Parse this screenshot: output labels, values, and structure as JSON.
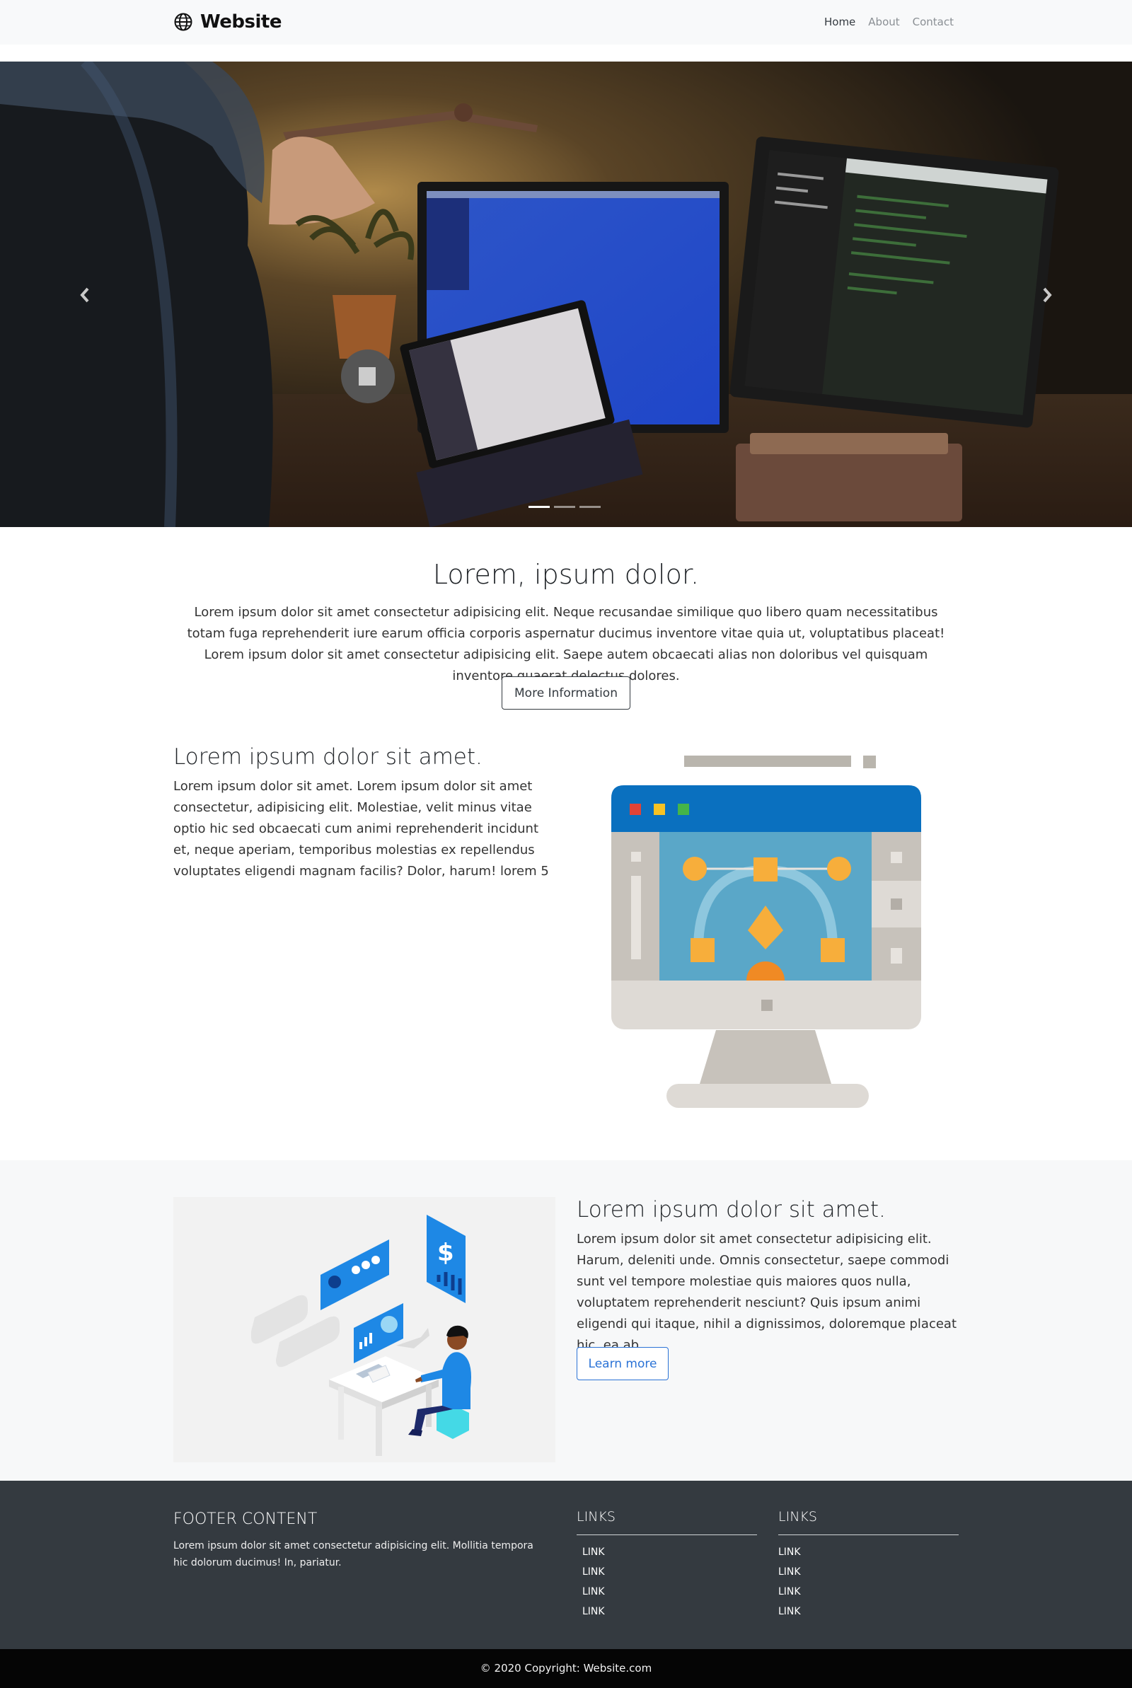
{
  "navbar": {
    "brand": "Website",
    "links": [
      "Home",
      "About",
      "Contact"
    ],
    "active": "Home"
  },
  "carousel": {
    "slide_count": 3,
    "active_slide": 1,
    "prev_icon": "chevron-left-icon",
    "next_icon": "chevron-right-icon"
  },
  "intro": {
    "title": "Lorem, ipsum dolor.",
    "text": "Lorem ipsum dolor sit amet consectetur adipisicing elit. Neque recusandae similique quo libero quam necessitatibus totam fuga reprehenderit iure earum officia corporis aspernatur ducimus inventore vitae quia ut, voluptatibus placeat! Lorem ipsum dolor sit amet consectetur adipisicing elit. Saepe autem obcaecati alias non doloribus vel quisquam inventore quaerat delectus dolores.",
    "button": "More Information"
  },
  "feature1": {
    "title": "Lorem ipsum dolor sit amet.",
    "text": "Lorem ipsum dolor sit amet. Lorem ipsum dolor sit amet consectetur, adipisicing elit. Molestiae, velit minus vitae optio hic sed obcaecati cum animi reprehenderit incidunt et, neque aperiam, temporibus molestias ex repellendus voluptates eligendi magnam facilis? Dolor, harum! lorem 5"
  },
  "feature2": {
    "title": "Lorem ipsum dolor sit amet.",
    "text": "Lorem ipsum dolor sit amet consectetur adipisicing elit. Harum, deleniti unde. Omnis consectetur, saepe commodi sunt vel tempore molestiae quis maiores quos nulla, voluptatem reprehenderit nesciunt? Quis ipsum animi eligendi qui itaque, nihil a dignissimos, doloremque placeat hic, ea ab.",
    "button": "Learn more"
  },
  "footer": {
    "title": "FOOTER CONTENT",
    "text": "Lorem ipsum dolor sit amet consectetur adipisicing elit. Mollitia tempora hic dolorum ducimus! In, pariatur.",
    "columns": [
      {
        "heading": "LINKS",
        "links": [
          "LINK",
          "LINK",
          "LINK",
          "LINK"
        ]
      },
      {
        "heading": "LINKS",
        "links": [
          "LINK",
          "LINK",
          "LINK",
          "LINK"
        ]
      }
    ],
    "copyright": "© 2020 Copyright: Website.com"
  },
  "colors": {
    "primary": "#2b73d6",
    "dark": "#343a40",
    "light": "#f8f9fa",
    "footer_bottom": "#050505"
  }
}
